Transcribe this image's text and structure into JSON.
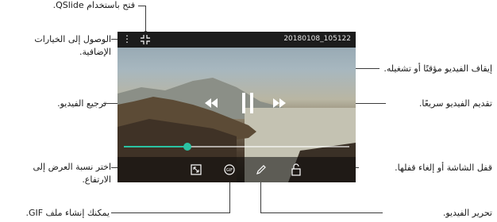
{
  "screen": {
    "filename": "20180108_105122"
  },
  "progress": {
    "value": 0.28
  },
  "callouts": {
    "qslide": "فتح باستخدام QSlide.",
    "more_options": [
      "الوصول إلى الخيارات",
      "الإضافية."
    ],
    "pause_play": "إيقاف الفيديو مؤقتًا أو تشغيله.",
    "rewind": "ترجيع الفيديو.",
    "fast_forward": "تقديم الفيديو سريعًا.",
    "aspect_ratio": [
      "اختر نسبة العرض إلى",
      "الارتفاع."
    ],
    "lock": "قفل الشاشة أو إلغاء قفلها.",
    "gif": "يمكنك إنشاء ملف GIF.",
    "edit": "تحرير الفيديو."
  },
  "colors": {
    "progress_accent": "#2bc3a3"
  }
}
